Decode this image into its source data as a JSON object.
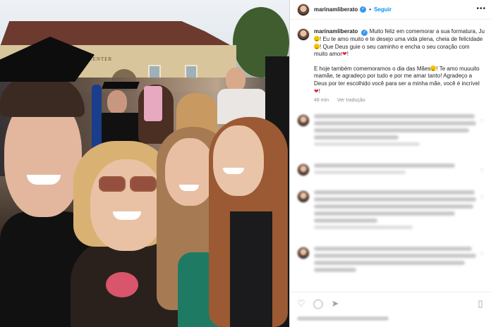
{
  "post": {
    "username": "marinamliberato",
    "follow_label": "Seguir",
    "separator": "•",
    "more_icon": "more-horizontal-icon",
    "caption": {
      "p1_a": "Muito feliz em comemorar a sua formatura, Ju",
      "p1_b": "! Eu te amo muito e te desejo uma vida plena, cheia de felicidade",
      "p1_c": "! Que Deus guie o seu caminho e encha o seu coração com muito amor",
      "p1_d": "!",
      "p2_a": "E hoje também comemoramos o dia das Mães",
      "p2_b": "! Te amo muuuito mamãe, te agradeço por tudo e por me amar tanto! Agradeço a Deus por ter escolhido você para ser a minha mãe, você é incrível",
      "p2_c": "!",
      "heart": "❤"
    },
    "meta": {
      "age": "48 min",
      "translate": "Ver tradução"
    }
  },
  "photo": {
    "building_sign": "'S CENTER"
  },
  "icons": {
    "like": "heart-icon",
    "comment": "comment-icon",
    "share": "share-icon",
    "save": "bookmark-icon"
  },
  "colors": {
    "accent": "#0095f6",
    "verified": "#3897f0",
    "heart": "#ed1d3b",
    "text": "#262626",
    "muted": "#8e8e8e"
  }
}
